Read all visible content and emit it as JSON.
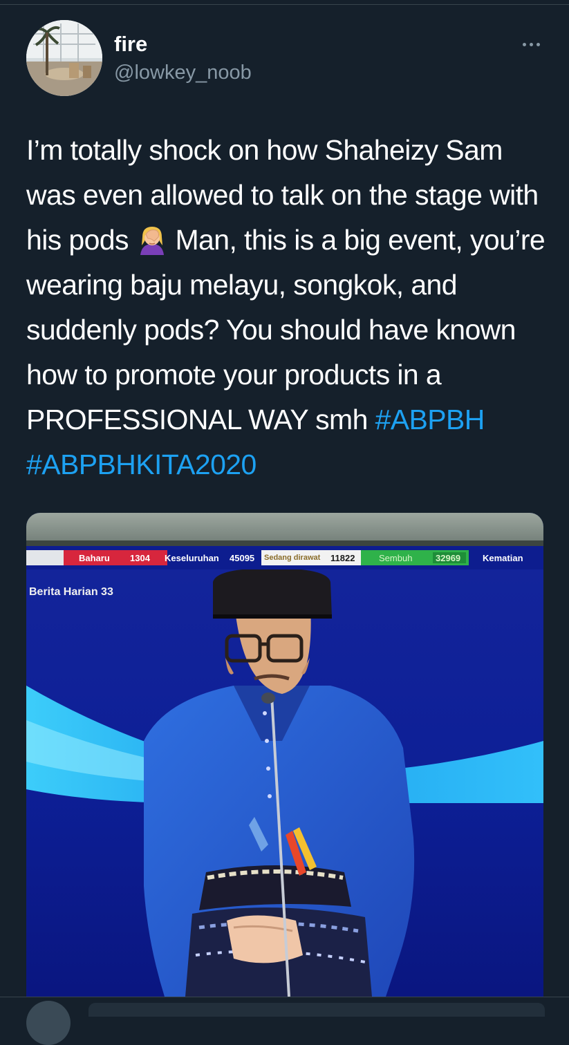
{
  "tweet": {
    "display_name": "fire",
    "handle": "@lowkey_noob",
    "more_icon": "more-horizontal-icon",
    "text_before_emoji": "I’m totally shock on how Shaheizy Sam was even allowed to talk on the stage with his pods ",
    "emoji": "person-facepalming-icon",
    "text_after_emoji": " Man, this is a big event, you’re wearing baju melayu, songkok, and suddenly pods? You should have known how to promote your products in a PROFESSIONAL WAY smh ",
    "hashtags": [
      "#ABPBH",
      "#ABPBHKITA2020"
    ],
    "hashtag_color": "#1da1f2"
  },
  "media": {
    "ticker": {
      "baharu_label": "Baharu",
      "baharu_value": "1304",
      "keseluruhan_label": "Keseluruhan",
      "keseluruhan_value": "45095",
      "dirawat_label": "Sedang dirawat",
      "dirawat_value": "11822",
      "sembuh_label": "Sembuh",
      "sembuh_value": "32969",
      "kematian_label": "Kematian"
    },
    "caption": "Berita Harian 33"
  },
  "colors": {
    "background": "#15202b",
    "secondary_text": "#8899a6",
    "divider": "#38444d"
  }
}
